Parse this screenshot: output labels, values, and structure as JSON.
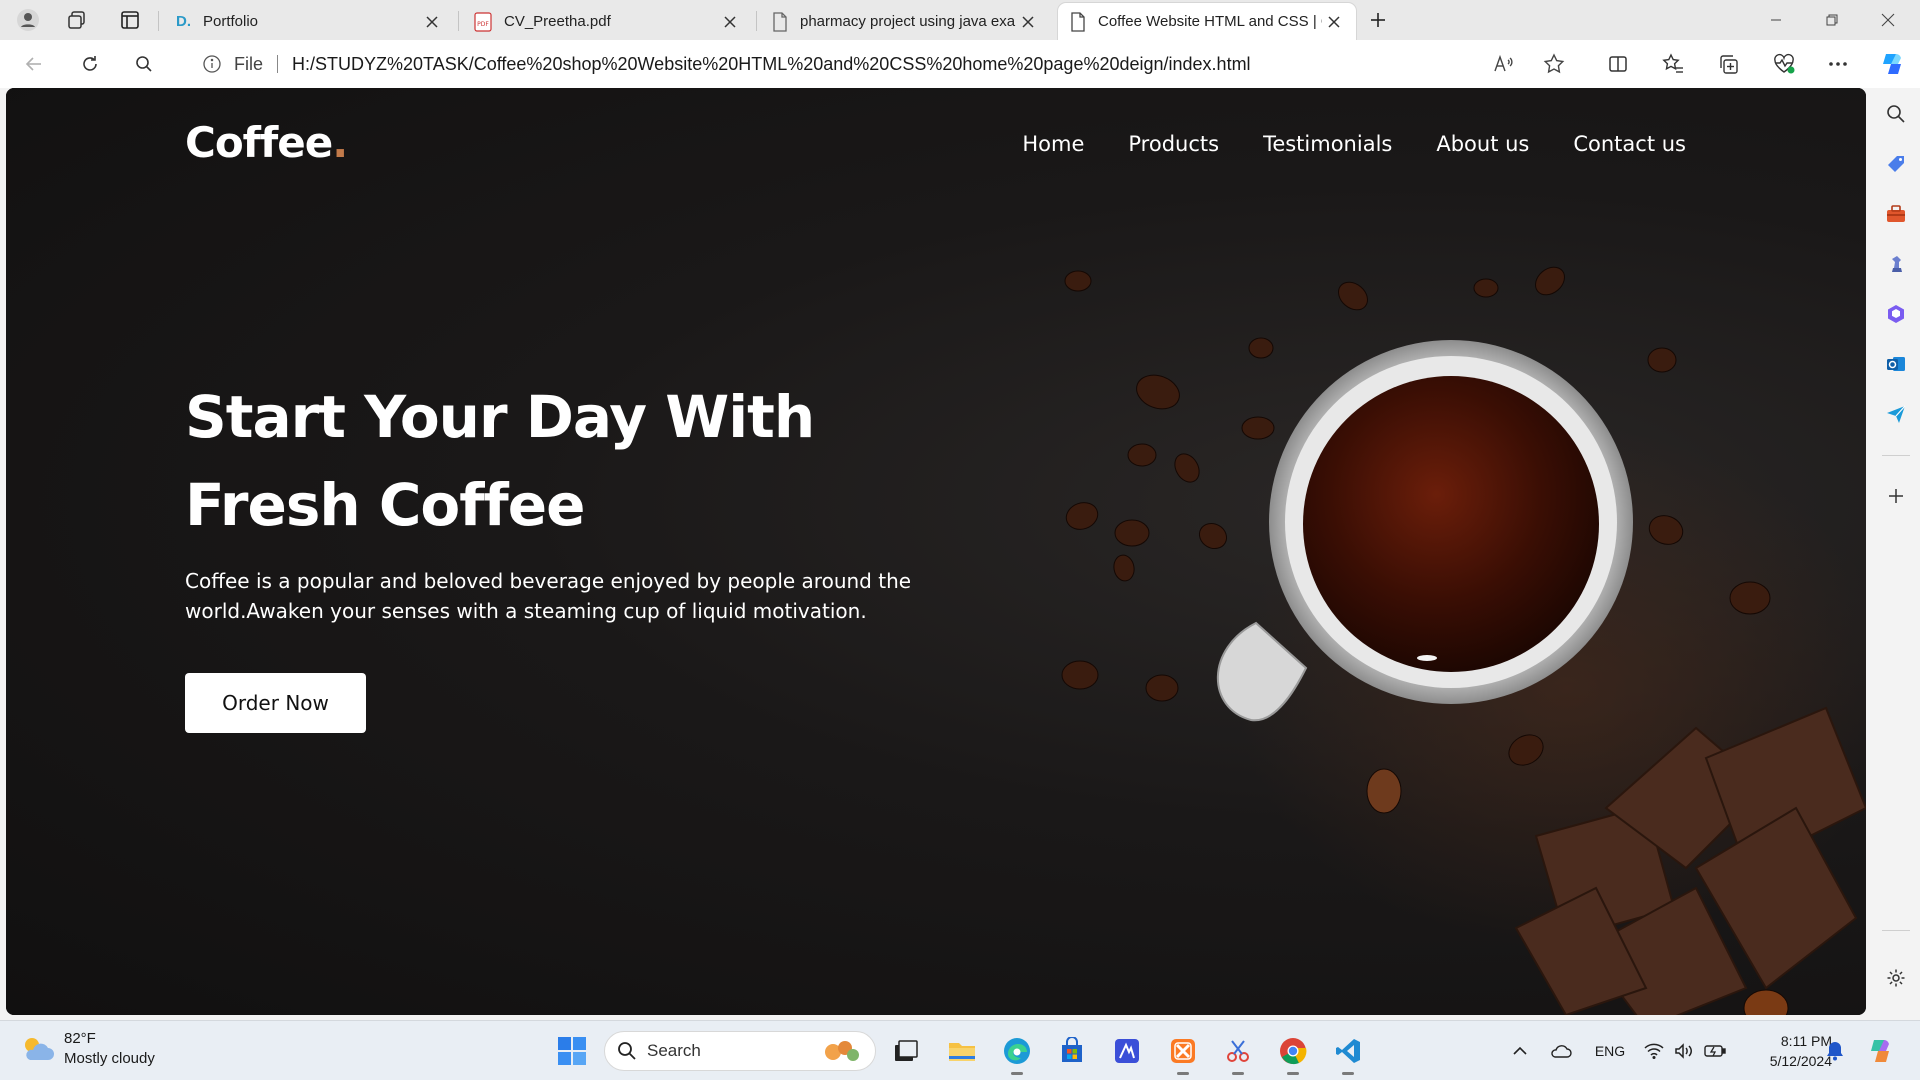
{
  "browser": {
    "tabs": [
      {
        "title": "Portfolio",
        "icon": "portfolio-favicon",
        "active": false
      },
      {
        "title": "CV_Preetha.pdf",
        "icon": "pdf-icon",
        "active": false
      },
      {
        "title": "pharmacy project using java exam",
        "icon": "page-icon",
        "active": false
      },
      {
        "title": "Coffee Website HTML and CSS | C",
        "icon": "page-icon",
        "active": true
      }
    ],
    "address": {
      "scheme_label": "File",
      "url": "H:/STUDYZ%20TASK/Coffee%20shop%20Website%20HTML%20and%20CSS%20home%20page%20deign/index.html"
    }
  },
  "site": {
    "logo": "Coffee",
    "logo_dot": ".",
    "nav": [
      "Home",
      "Products",
      "Testimonials",
      "About us",
      "Contact us"
    ],
    "hero": {
      "title_line1": "Start Your Day With",
      "title_line2": "Fresh Coffee",
      "text": "Coffee is a popular and beloved beverage enjoyed by people around the world.Awaken your senses with a steaming cup of liquid motivation.",
      "button": "Order Now"
    },
    "colors": {
      "background": "#141313",
      "accent": "#c27a4a",
      "text": "#ffffff"
    }
  },
  "taskbar": {
    "weather": {
      "temp": "82°F",
      "condition": "Mostly cloudy"
    },
    "search_label": "Search",
    "tray": {
      "language": "ENG"
    },
    "clock": {
      "time": "8:11 PM",
      "date": "5/12/2024"
    }
  }
}
